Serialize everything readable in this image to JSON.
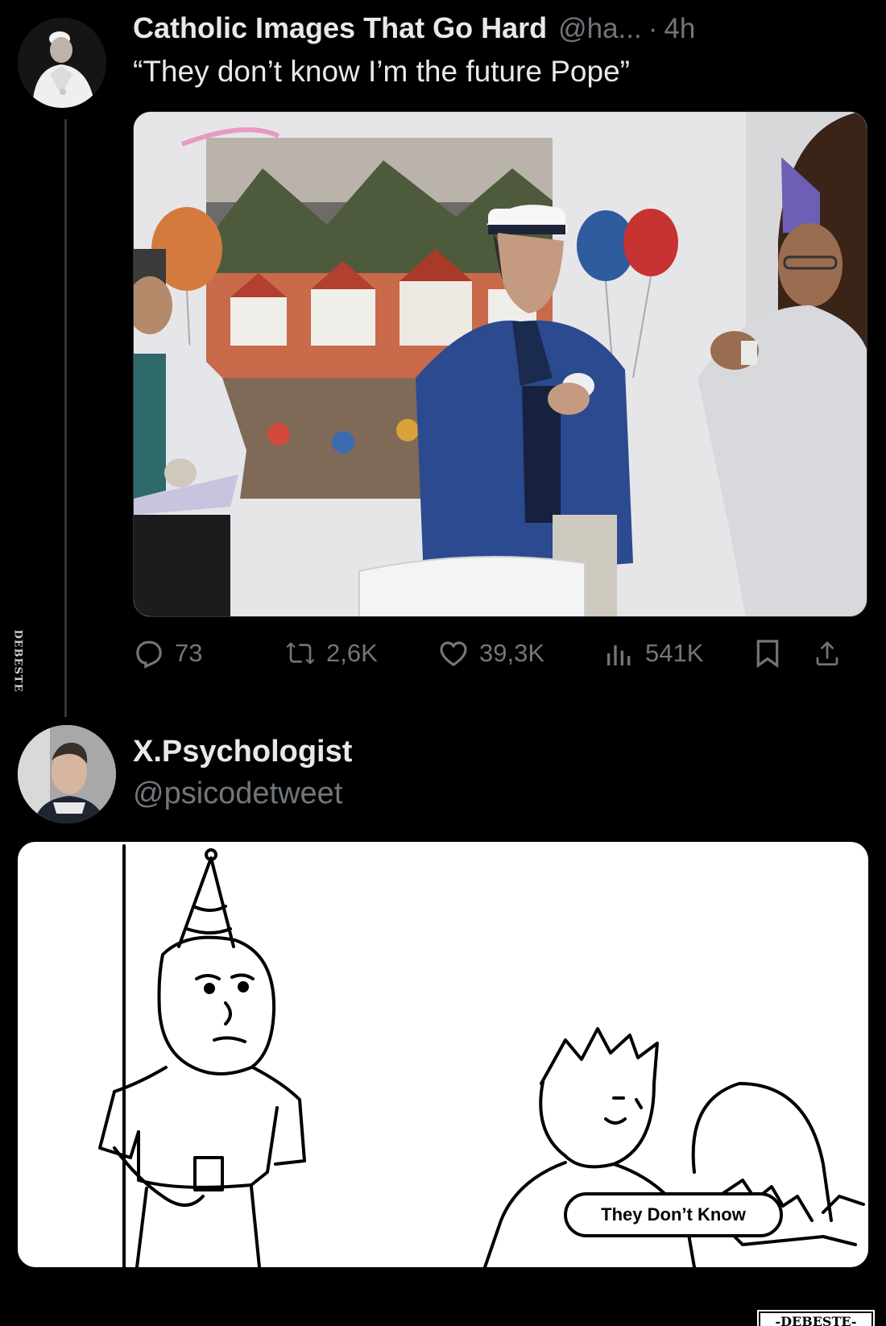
{
  "watermark": {
    "side_text": "DEBESTE",
    "bottom_text": "-DEBESTE-"
  },
  "tweet": {
    "author": {
      "display_name": "Catholic Images That Go Hard",
      "handle": "@ha...",
      "avatar_alt": "avatar"
    },
    "separator": "·",
    "timestamp": "4h",
    "text": "“They don’t know I’m the future Pope”",
    "media": {
      "description_icon": "party-photo"
    },
    "actions": {
      "replies": "73",
      "retweets": "2,6K",
      "likes": "39,3K",
      "views": "541K",
      "reply_icon": "reply-icon",
      "retweet_icon": "retweet-icon",
      "like_icon": "heart-icon",
      "views_icon": "views-icon",
      "bookmark_icon": "bookmark-icon",
      "share_icon": "share-icon"
    }
  },
  "reply": {
    "author": {
      "display_name": "X.Psychologist",
      "handle": "@psicodetweet"
    },
    "meme": {
      "caption": "They Don’t Know"
    }
  },
  "colors": {
    "background": "#000000",
    "text_primary": "#e7e9ea",
    "text_secondary": "#71767b",
    "thread_line": "#333639"
  }
}
